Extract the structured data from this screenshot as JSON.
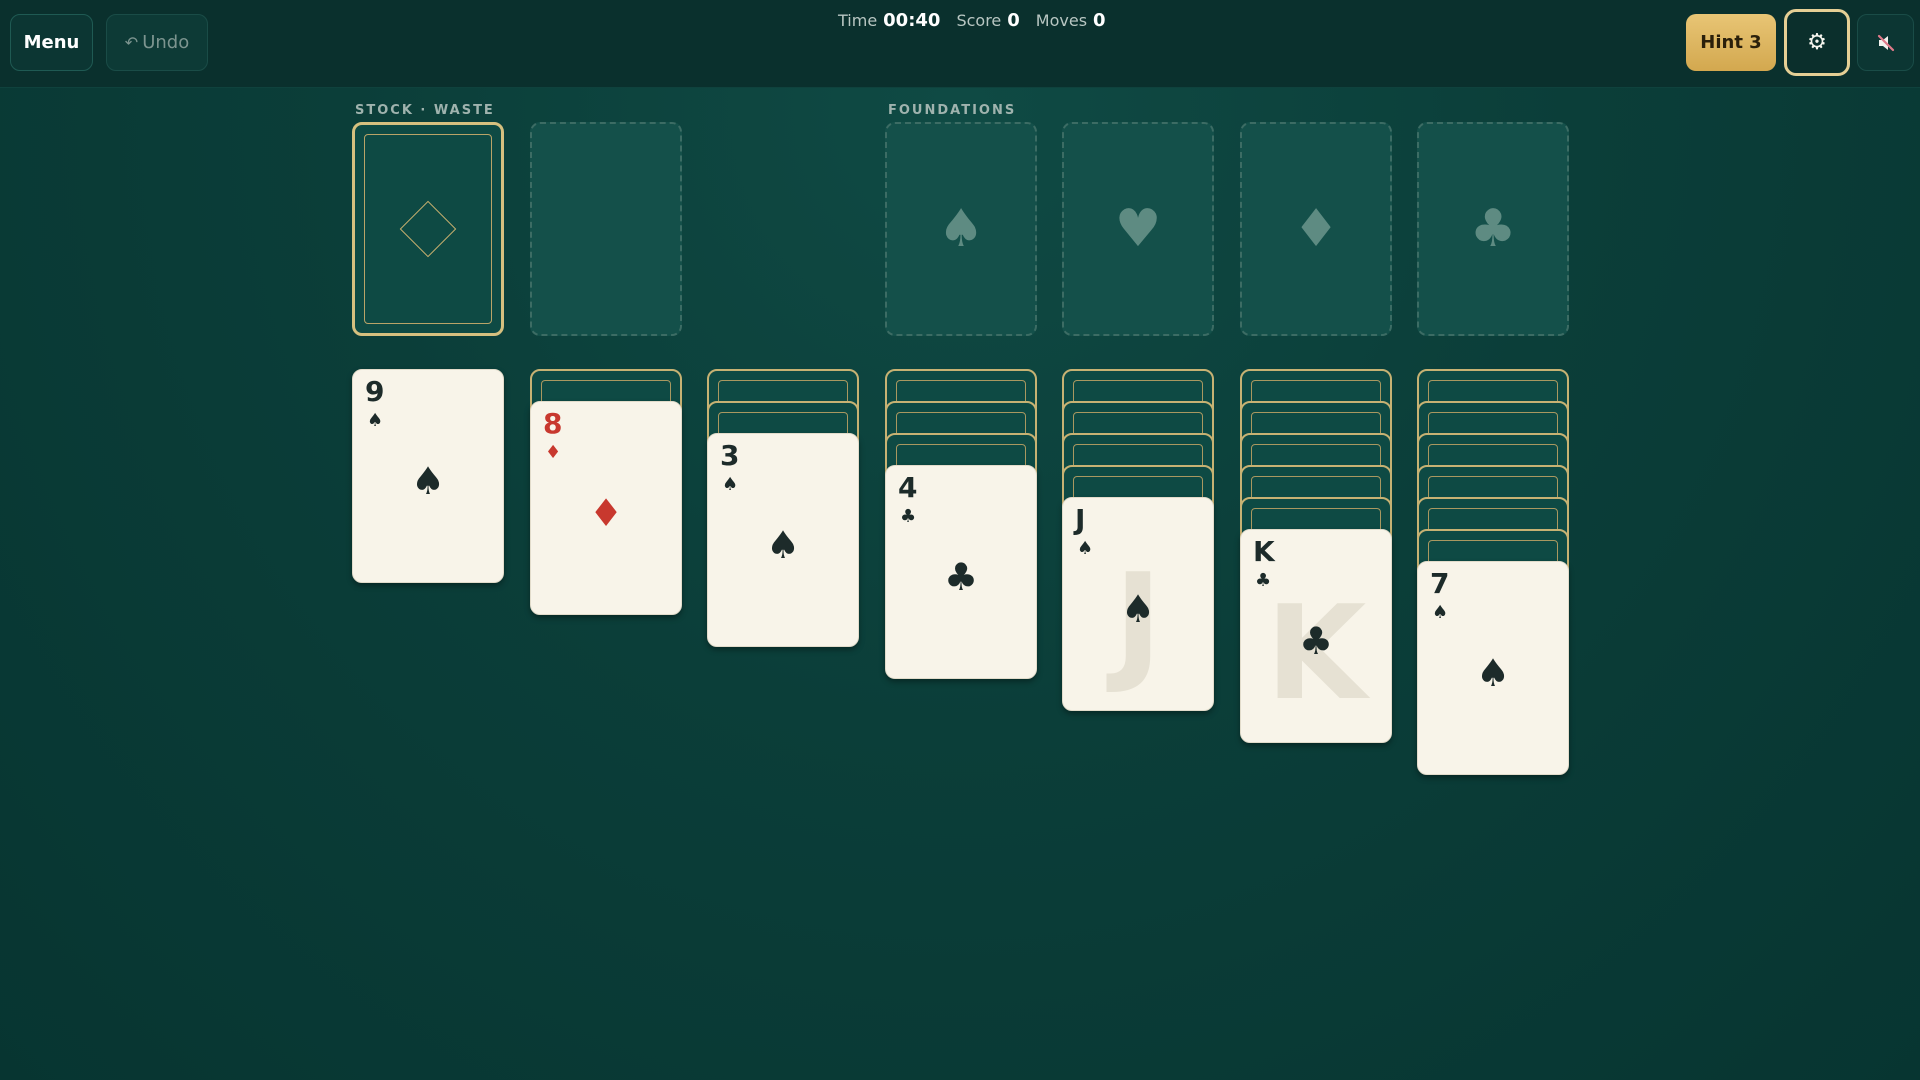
{
  "toolbar": {
    "menu_label": "Menu",
    "undo_label": "Undo",
    "undo_icon": "↶",
    "hint_label": "Hint 3",
    "settings_icon": "⚙",
    "mute_icon": "speaker-muted-icon"
  },
  "stats": {
    "time_label": "Time",
    "time_value": "00:40",
    "score_label": "Score",
    "score_value": "0",
    "moves_label": "Moves",
    "moves_value": "0"
  },
  "labels": {
    "stock_waste": "STOCK · WASTE",
    "foundations": "FOUNDATIONS"
  },
  "foundations": [
    {
      "suit": "spades",
      "glyph": "♠"
    },
    {
      "suit": "hearts",
      "glyph": "♥"
    },
    {
      "suit": "diamonds",
      "glyph": "♦"
    },
    {
      "suit": "clubs",
      "glyph": "♣"
    }
  ],
  "tableau": [
    {
      "face_down": 0,
      "top": {
        "rank": "9",
        "suit": "♠",
        "color": "black",
        "watermark": false
      }
    },
    {
      "face_down": 1,
      "top": {
        "rank": "8",
        "suit": "♦",
        "color": "red",
        "watermark": false
      }
    },
    {
      "face_down": 2,
      "top": {
        "rank": "3",
        "suit": "♠",
        "color": "black",
        "watermark": false
      }
    },
    {
      "face_down": 3,
      "top": {
        "rank": "4",
        "suit": "♣",
        "color": "black",
        "watermark": false
      }
    },
    {
      "face_down": 4,
      "top": {
        "rank": "J",
        "suit": "♠",
        "color": "black",
        "watermark": true
      }
    },
    {
      "face_down": 5,
      "top": {
        "rank": "K",
        "suit": "♣",
        "color": "black",
        "watermark": true
      }
    },
    {
      "face_down": 6,
      "top": {
        "rank": "7",
        "suit": "♠",
        "color": "black",
        "watermark": false
      }
    }
  ],
  "colors": {
    "felt": "#0b3e39",
    "card_face": "#f8f4e9",
    "gold_accent": "#d6c07f",
    "hint_button": "#e0bb68",
    "red_suit": "#c8382e"
  }
}
